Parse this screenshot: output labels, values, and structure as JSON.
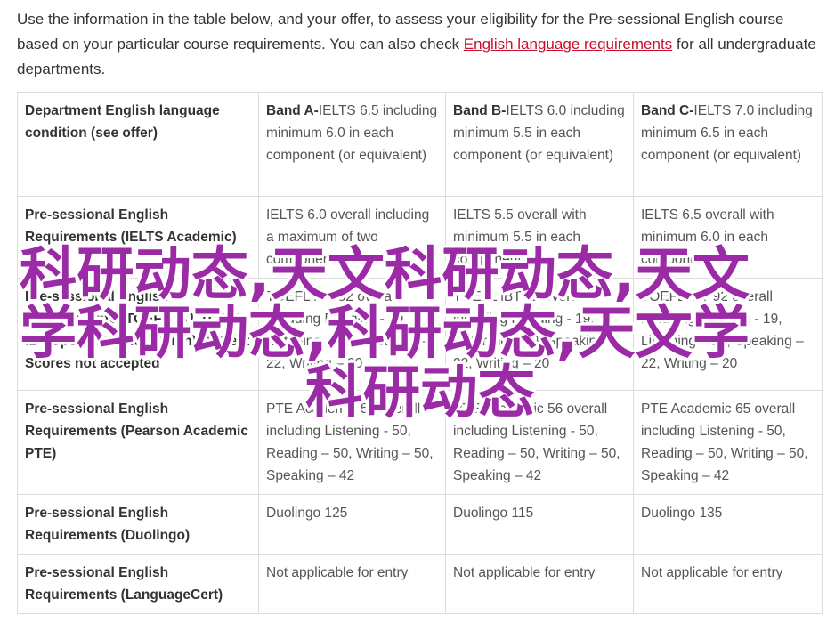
{
  "intro": {
    "text_before_link": "Use the information in the table below, and your offer, to assess your eligibility for the Pre-sessional English course based on your particular course requirements. You can also check ",
    "link_text": "English language requirements",
    "text_after_link": " for all undergraduate departments."
  },
  "table": {
    "header": {
      "label": "Department English language condition (see offer)",
      "bands": [
        {
          "name": "Band A-",
          "desc": "IELTS 6.5 including minimum 6.0 in each component (or equivalent)"
        },
        {
          "name": "Band B-",
          "desc": "IELTS 6.0 including minimum 5.5 in each component (or equivalent)"
        },
        {
          "name": "Band C-",
          "desc": "IELTS 7.0 including minimum 6.5 in each component (or equivalent)"
        }
      ]
    },
    "rows": [
      {
        "label": "Pre-sessional English Requirements (IELTS Academic)",
        "cells": [
          "IELTS 6.0 overall including a maximum of two components at 5.5",
          "IELTS 5.5 overall with minimum 5.5 in each component",
          "IELTS 6.5 overall with minimum 6.0 in each component score"
        ]
      },
      {
        "label": "Pre-sessional English Requirements (TOEFL iBT TOEFL iBT Special Home Edition) MyBest Scores not accepted",
        "cells": [
          "TOEFL iBT 82 overall including Reading - 19, Listening – 19, Speaking – 22, Writing – 20",
          "TOEFL iBT 82 overall including Reading - 19, Listening – 19, Speaking – 22, Writing – 20",
          "TOEFL iBT 92 overall including Reading - 19, Listening – 19, Speaking – 22, Writing – 20"
        ]
      },
      {
        "label": "Pre-sessional English Requirements (Pearson Academic PTE)",
        "cells": [
          "PTE Academic 58 overall including Listening - 50, Reading – 50, Writing – 50, Speaking – 42",
          "PTE Academic 56 overall including Listening - 50, Reading – 50, Writing – 50, Speaking – 42",
          "PTE Academic 65 overall including Listening - 50, Reading – 50, Writing – 50, Speaking – 42"
        ]
      },
      {
        "label": "Pre-sessional English Requirements (Duolingo)",
        "cells": [
          "Duolingo 125",
          "Duolingo 115",
          "Duolingo 135"
        ]
      },
      {
        "label": "Pre-sessional English Requirements (LanguageCert)",
        "cells": [
          "Not applicable for entry",
          "Not applicable for entry",
          "Not applicable for entry"
        ]
      }
    ]
  },
  "watermark": {
    "line1": "科研动态,天文科研动态,天文",
    "line2": "学科研动态,科研动态,天文学",
    "line3": "科研动态",
    "color": "#9b2aa6"
  }
}
